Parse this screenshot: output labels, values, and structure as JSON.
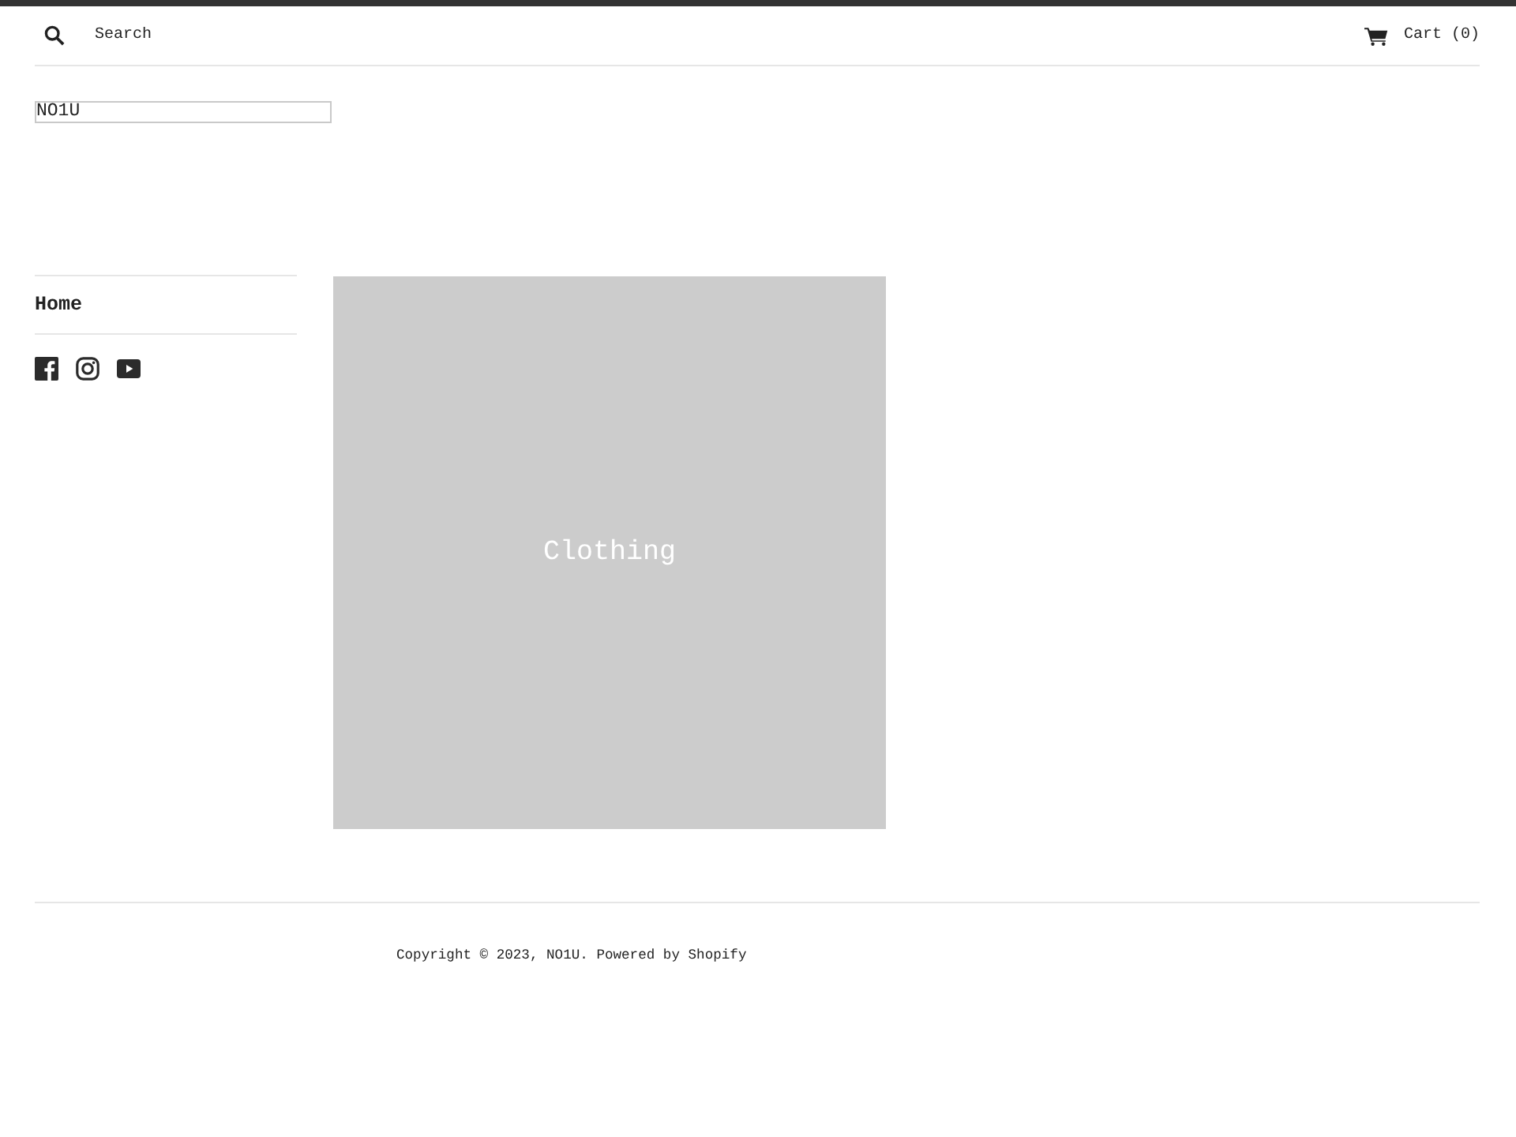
{
  "header": {
    "search": {
      "placeholder": "Search"
    },
    "cart": {
      "label": "Cart (0)"
    }
  },
  "logo": {
    "text": "NO1U"
  },
  "sidebar": {
    "nav": [
      {
        "label": "Home"
      }
    ],
    "social": [
      {
        "kind": "facebook"
      },
      {
        "kind": "instagram"
      },
      {
        "kind": "youtube"
      }
    ]
  },
  "collections": [
    {
      "title": "Clothing"
    }
  ],
  "footer": {
    "copyright": "Copyright © 2023, NO1U. Powered by Shopify"
  }
}
